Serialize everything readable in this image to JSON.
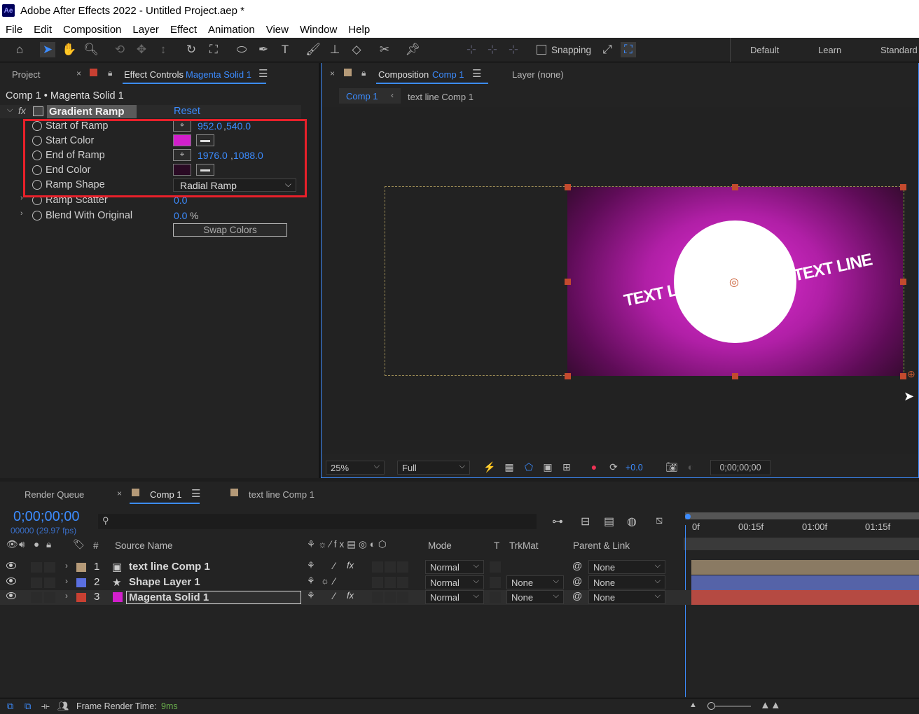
{
  "app": {
    "logo": "Ae",
    "title": "Adobe After Effects 2022 - Untitled Project.aep *"
  },
  "menu": [
    "File",
    "Edit",
    "Composition",
    "Layer",
    "Effect",
    "Animation",
    "View",
    "Window",
    "Help"
  ],
  "toolbar": {
    "snapping": "Snapping",
    "workspaces": [
      "Default",
      "Learn",
      "Standard"
    ]
  },
  "left_panel": {
    "tab_project": "Project",
    "tab_effect_controls": "Effect Controls",
    "tab_effect_layer": "Magenta Solid 1",
    "breadcrumb": "Comp 1 • Magenta Solid 1",
    "effect_name": "Gradient Ramp",
    "reset": "Reset",
    "props": [
      {
        "name": "Start of Ramp",
        "value_x": "952.0",
        "value_y": "540.0"
      },
      {
        "name": "Start Color",
        "color": "#d21fcc"
      },
      {
        "name": "End of Ramp",
        "value_x": "1976.0",
        "value_y": "1088.0"
      },
      {
        "name": "End Color",
        "color": "#2a0a24"
      },
      {
        "name": "Ramp Shape",
        "value": "Radial Ramp"
      },
      {
        "name": "Ramp Scatter",
        "value": "0.0"
      },
      {
        "name": "Blend With Original",
        "value": "0.0",
        "unit": "%"
      }
    ],
    "swap_button": "Swap Colors",
    "highlight_color": "#e8202a"
  },
  "comp_panel": {
    "tab_composition": "Composition",
    "tab_comp_name": "Comp 1",
    "tab_layer": "Layer (none)",
    "flow_comp1": "Comp 1",
    "flow_textline": "text line Comp 1",
    "text_art": "TEXT LINE",
    "zoom": "25%",
    "resolution": "Full",
    "exposure": "+0.0",
    "timecode": "0;00;00;00"
  },
  "timeline": {
    "tab_render": "Render Queue",
    "tab_comp1": "Comp 1",
    "tab_textline": "text line Comp 1",
    "timecode": "0;00;00;00",
    "fps": "00000 (29.97 fps)",
    "headers": {
      "num": "#",
      "source": "Source Name",
      "mode": "Mode",
      "t": "T",
      "trkmat": "TrkMat",
      "parent": "Parent & Link"
    },
    "ruler": [
      "0f",
      "00:15f",
      "01:00f",
      "01:15f"
    ],
    "layers": [
      {
        "num": "1",
        "name": "text line Comp 1",
        "label": "#b59a78",
        "mode": "Normal",
        "trkmat": "",
        "parent": "None",
        "bar": "#8a7a63"
      },
      {
        "num": "2",
        "name": "Shape Layer 1",
        "label": "#5a6fe0",
        "mode": "Normal",
        "trkmat": "None",
        "parent": "None",
        "bar": "#5563a8"
      },
      {
        "num": "3",
        "name": "Magenta Solid 1",
        "label": "#c84032",
        "mode": "Normal",
        "trkmat": "None",
        "parent": "None",
        "bar": "#b54a42"
      }
    ]
  },
  "status": {
    "label": "Frame Render Time:",
    "value": "9ms"
  }
}
